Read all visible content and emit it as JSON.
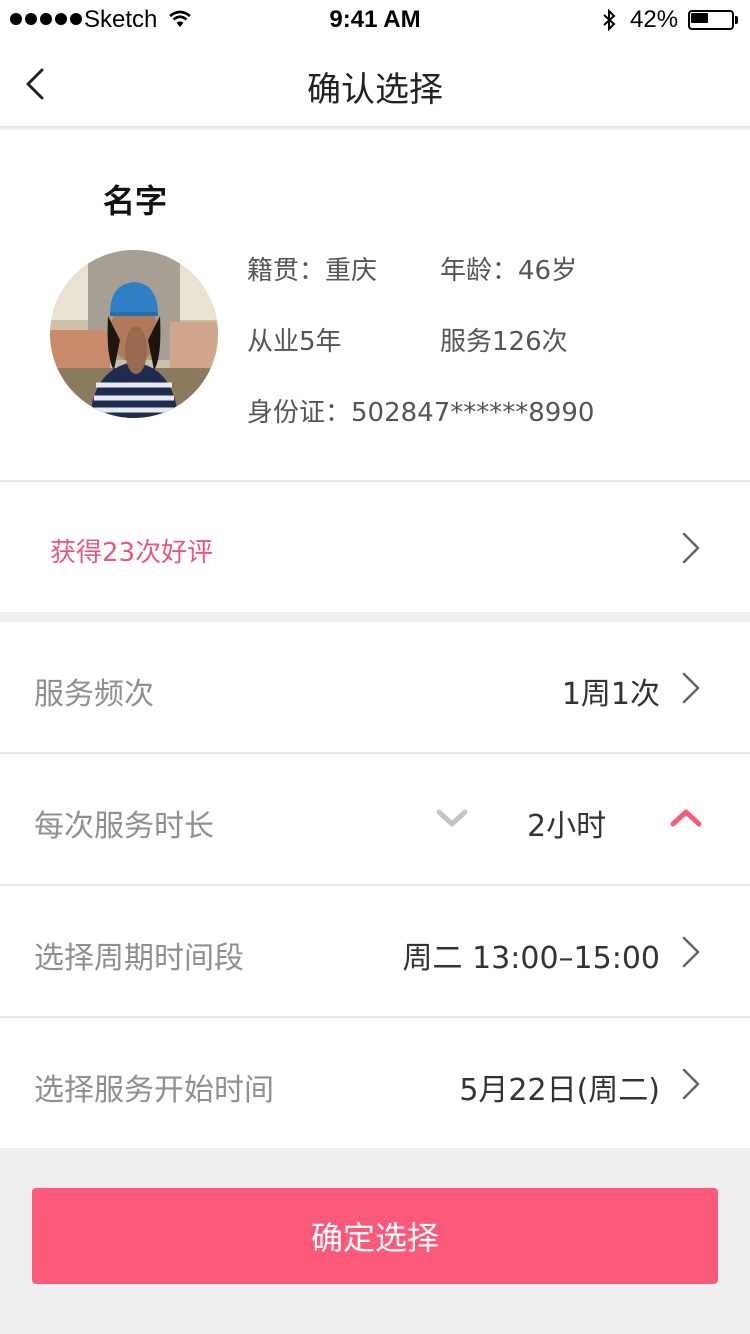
{
  "status_bar": {
    "carrier": "Sketch",
    "time": "9:41 AM",
    "battery_percent": "42%",
    "battery_level": 0.42
  },
  "nav": {
    "title": "确认选择",
    "back_icon": "chevron-left-icon"
  },
  "profile": {
    "name": "名字",
    "native_place": "籍贯：重庆",
    "age": "年龄：46岁",
    "years_in_service": "从业5年",
    "service_count": "服务126次",
    "id_card": "身份证：502847******8990"
  },
  "praise": {
    "text": "获得23次好评"
  },
  "options": {
    "frequency": {
      "label": "服务频次",
      "value": "1周1次"
    },
    "duration": {
      "label": "每次服务时长",
      "value": "2小时"
    },
    "period": {
      "label": "选择周期时间段",
      "value": "周二 13:00–15:00"
    },
    "start": {
      "label": "选择服务开始时间",
      "value": "5月22日(周二)"
    }
  },
  "confirm_button": "确定选择",
  "colors": {
    "accent": "#fd5a7b",
    "praise_text": "#ea5879",
    "label_gray": "#8f8f8f",
    "background": "#efefef"
  }
}
